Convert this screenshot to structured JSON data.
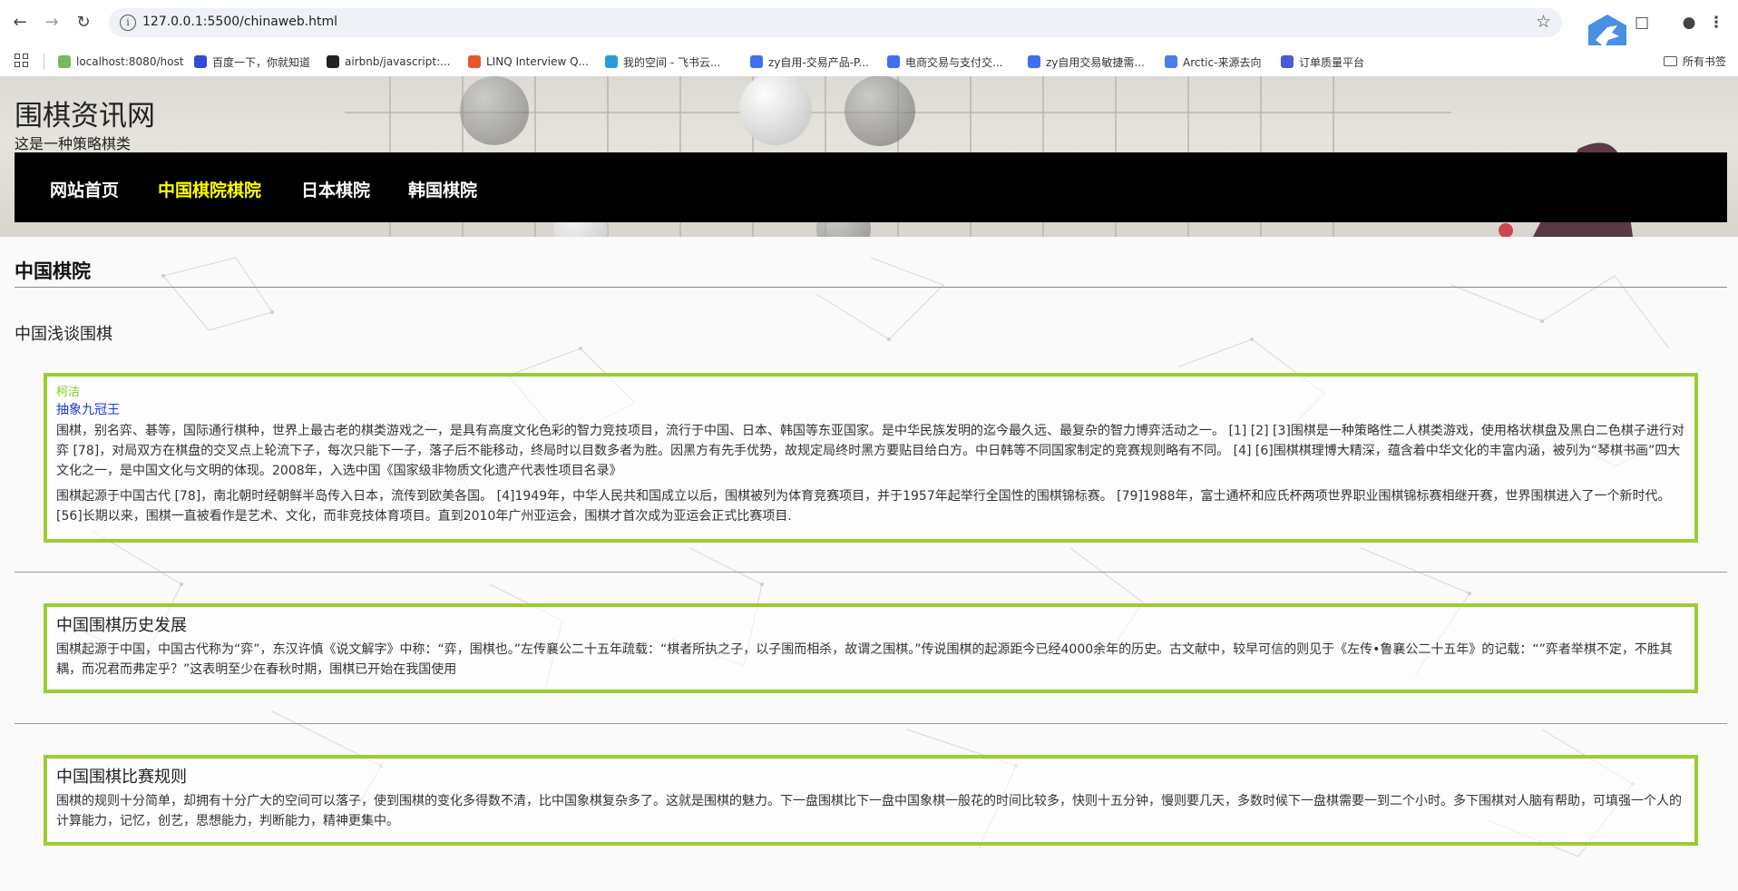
{
  "browser": {
    "url": "127.0.0.1:5500/chinaweb.html",
    "bookmarks": [
      {
        "label": "localhost:8080/host",
        "color": "#7bb661"
      },
      {
        "label": "百度一下，你就知道",
        "color": "#2f4bd8"
      },
      {
        "label": "airbnb/javascript:...",
        "color": "#222222"
      },
      {
        "label": "LINQ Interview Q...",
        "color": "#e8542e"
      },
      {
        "label": "我的空间 - 飞书云...",
        "color": "#2d9ad8"
      },
      {
        "label": "zy自用-交易产品-P...",
        "color": "#3d6ff0"
      },
      {
        "label": "电商交易与支付交...",
        "color": "#3d6ff0"
      },
      {
        "label": "zy自用交易敏捷需...",
        "color": "#3d6ff0"
      },
      {
        "label": "Arctic-来源去向",
        "color": "#4a7df0"
      },
      {
        "label": "订单质量平台",
        "color": "#4a5bd8"
      }
    ],
    "all_bookmarks_label": "所有书签"
  },
  "site": {
    "title": "围棋资讯网",
    "subtitle": "这是一种策略棋类",
    "nav": [
      {
        "label": "网站首页",
        "active": false
      },
      {
        "label": "中国棋院棋院",
        "active": true
      },
      {
        "label": "日本棋院",
        "active": false
      },
      {
        "label": "韩国棋院",
        "active": false
      }
    ],
    "accent_color": "#9acd32",
    "active_nav_color": "#ffff00"
  },
  "main": {
    "section_heading": "中国棋院",
    "intro_heading": "中国浅谈围棋",
    "card1": {
      "author": "柯洁",
      "award": "抽象九冠王",
      "p1": "围棋，别名弈、碁等，国际通行棋种，世界上最古老的棋类游戏之一，是具有高度文化色彩的智力竞技项目，流行于中国、日本、韩国等东亚国家。是中华民族发明的迄今最久远、最复杂的智力博弈活动之一。 [1] [2] [3]围棋是一种策略性二人棋类游戏，使用格状棋盘及黑白二色棋子进行对弈 [78]，对局双方在棋盘的交叉点上轮流下子，每次只能下一子，落子后不能移动，终局时以目数多者为胜。因黑方有先手优势，故规定局终时黑方要贴目给白方。中日韩等不同国家制定的竞赛规则略有不同。 [4] [6]围棋棋理博大精深，蕴含着中华文化的丰富内涵，被列为“琴棋书画”四大文化之一，是中国文化与文明的体现。2008年，入选中国《国家级非物质文化遗产代表性项目名录》",
      "p2": "围棋起源于中国古代 [78]，南北朝时经朝鲜半岛传入日本，流传到欧美各国。 [4]1949年，中华人民共和国成立以后，围棋被列为体育竞赛项目，并于1957年起举行全国性的围棋锦标赛。 [79]1988年，富士通杯和应氏杯两项世界职业围棋锦标赛相继开赛，世界围棋进入了一个新时代。 [56]长期以来，围棋一直被看作是艺术、文化，而非竞技体育项目。直到2010年广州亚运会，围棋才首次成为亚运会正式比赛项目."
    },
    "card2": {
      "title": "中国围棋历史发展",
      "p1": "围棋起源于中国，中国古代称为“弈”，东汉许慎《说文解字》中称：“弈，围棋也。”左传襄公二十五年疏载：“棋者所执之子，以子围而相杀，故谓之围棋。”传说围棋的起源距今已经4000余年的历史。古文献中，较早可信的则见于《左传•鲁襄公二十五年》的记载：“”弈者举棋不定，不胜其耦，而况君而弗定乎？”这表明至少在春秋时期，围棋已开始在我国使用"
    },
    "card3": {
      "title": "中国围棋比赛规则",
      "p1": "围棋的规则十分简单，却拥有十分广大的空间可以落子，使到围棋的变化多得数不清，比中国象棋复杂多了。这就是围棋的魅力。下一盘围棋比下一盘中国象棋一般花的时间比较多，快则十五分钟，慢则要几天，多数时候下一盘棋需要一到二个小时。多下围棋对人脑有帮助，可填强一个人的计算能力，记忆，创艺，思想能力，判断能力，精神更集中。"
    }
  }
}
